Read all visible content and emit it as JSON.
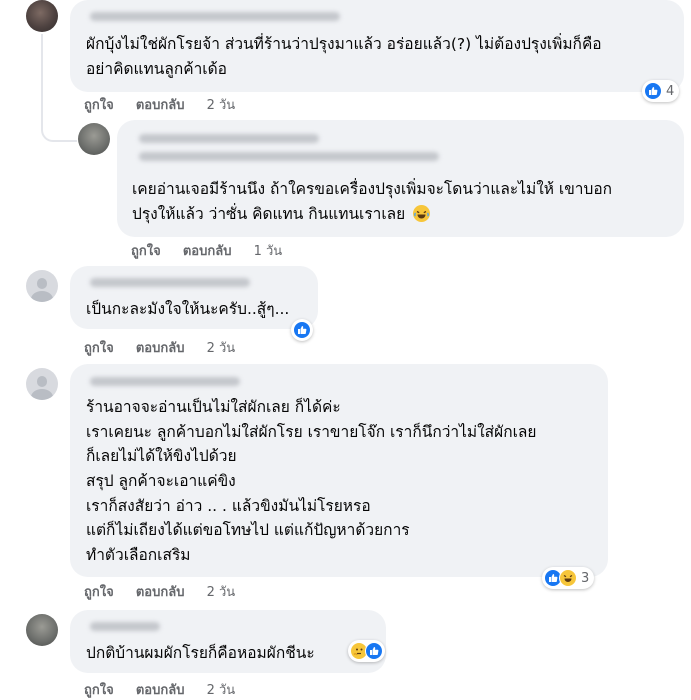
{
  "actions": {
    "like": "ถูกใจ",
    "reply": "ตอบกลับ"
  },
  "comments": [
    {
      "lines": [
        "ผักบุ้งไม่ใช่ผักโรยจ้า ส่วนที่ร้านว่าปรุงมาแล้ว อร่อยแล้ว(?) ไม่ต้องปรุงเพิ่มก็คือ",
        "อย่าคิดแทนลูกค้าเด้อ"
      ],
      "time": "2 วัน",
      "reaction_count": "4",
      "reactions": [
        "like-icon"
      ]
    },
    {
      "lines": [
        "เคยอ่านเจอมีร้านนึง ถ้าใครขอเครื่องปรุงเพิ่มจะโดนว่าและไม่ให้ เขาบอก",
        "ปรุงให้แล้ว ว่าซั่น คิดแทน กินแทนเราเลย"
      ],
      "time": "1 วัน",
      "inline_emoji": "laughing-crying-emoji"
    },
    {
      "lines": [
        "เป็นกะละมังใจให้นะครับ..สู้ๆ..."
      ],
      "time": "2 วัน",
      "reactions": [
        "like-icon"
      ]
    },
    {
      "lines": [
        "ร้านอาจจะอ่านเป็นไม่ใส่ผักเลย ก็ได้ค่ะ",
        "เราเคยนะ ลูกค้าบอกไม่ใส่ผักโรย เราขายโจ๊ก เราก็นึกว่าไม่ใส่ผักเลย",
        "ก็เลยไม่ได้ให้ขิงไปด้วย",
        "สรุป ลูกค้าจะเอาแค่ขิง",
        "เราก็สงสัยว่า อ่าว .. . แล้วขิงมันไม่โรยหรอ",
        "แต่ก็ไม่เถียงได้แต่ขอโทษไป แต่แก้ปัญหาด้วยการ",
        "ทำตัวเลือกเสริม"
      ],
      "time": "2 วัน",
      "reaction_count": "3",
      "reactions": [
        "like-icon",
        "haha-icon"
      ]
    },
    {
      "lines": [
        "ปกติบ้านผมผักโรยก็คือหอมผักชีนะ"
      ],
      "time": "2 วัน",
      "reactions": [
        "like-icon",
        "thinking-icon"
      ]
    }
  ],
  "colors": {
    "bubble": "#f0f2f5",
    "action_text": "#65676b",
    "like_blue": "#1877f2",
    "emoji_yellow": "#f7c63a"
  }
}
